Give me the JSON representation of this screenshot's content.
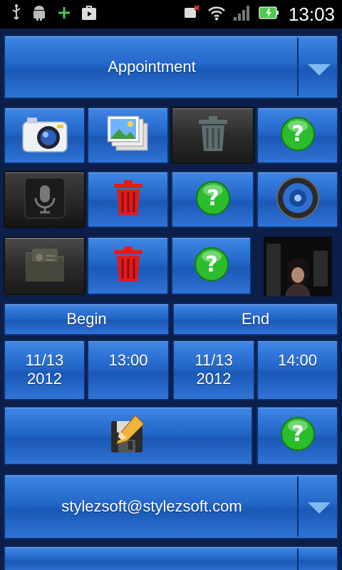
{
  "status_bar": {
    "time": "13:03",
    "icons": [
      "usb-icon",
      "android-debug-icon",
      "plus-icon",
      "play-store-icon",
      "muted-call-icon",
      "wifi-icon",
      "signal-icon",
      "battery-icon"
    ]
  },
  "appointment": {
    "label": "Appointment"
  },
  "schedule": {
    "begin_label": "Begin",
    "end_label": "End",
    "begin_date": "11/13\n2012",
    "begin_time": "13:00",
    "end_date": "11/13\n2012",
    "end_time": "14:00"
  },
  "email": {
    "value": "stylezsoft@stylezsoft.com"
  },
  "colors": {
    "button_blue": "#2a6fd0",
    "button_border": "#0e2f6a",
    "help_green": "#2bbd2b",
    "trash_red": "#e01b1b"
  }
}
